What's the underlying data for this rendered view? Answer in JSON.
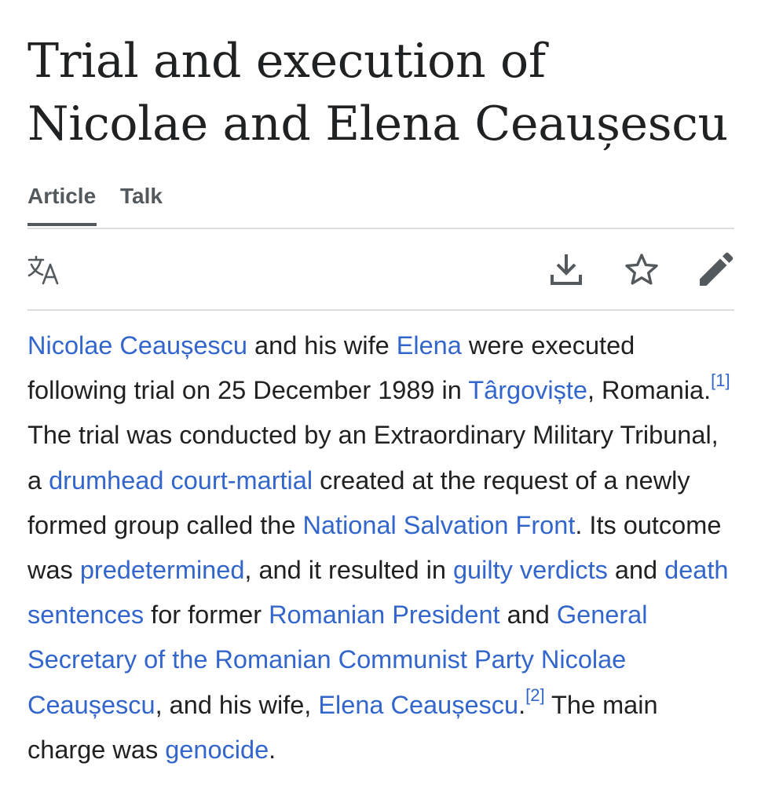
{
  "article": {
    "title": "Trial and execution of Nicolae and Elena Ceaușescu"
  },
  "tabs": {
    "article": "Article",
    "talk": "Talk"
  },
  "toolbar": {
    "language_icon": "translate-icon",
    "download_icon": "download-icon",
    "watch_icon": "star-icon",
    "edit_icon": "pencil-icon"
  },
  "colors": {
    "link": "#3366cc",
    "text": "#202122",
    "icon": "#54595d",
    "divider": "#dadde0"
  },
  "paragraph": {
    "p01_link": "Nicolae Ceaușescu",
    "p02_text": " and his wife ",
    "p03_link": "Elena",
    "p04_text": " were executed following trial on 25 December 1989 in ",
    "p05_link": "Târgoviște",
    "p06_text": ", Romania.",
    "p07_ref": "[1]",
    "p08_text": " The trial was conducted by an Extraordinary Military Tribunal, a ",
    "p09_link": "drumhead court-martial",
    "p10_text": " created at the request of a newly formed group called the ",
    "p11_link": "National Salvation Front",
    "p12_text": ". Its outcome was ",
    "p13_link": "predetermined",
    "p14_text": ", and it resulted in ",
    "p15_link": "guilty verdicts",
    "p16_text": " and ",
    "p17_link": "death sentences",
    "p18_text": " for former ",
    "p19_link": "Romanian President",
    "p20_text": " and ",
    "p21_link": "General Secretary of the Romanian Communist Party",
    "p22_text": " ",
    "p23_link": "Nicolae Ceaușescu",
    "p24_text": ", and his wife, ",
    "p25_link": "Elena Ceaușescu",
    "p26_text": ".",
    "p27_ref": "[2]",
    "p28_text": " The main charge was ",
    "p29_link": "genocide",
    "p30_text": "."
  }
}
